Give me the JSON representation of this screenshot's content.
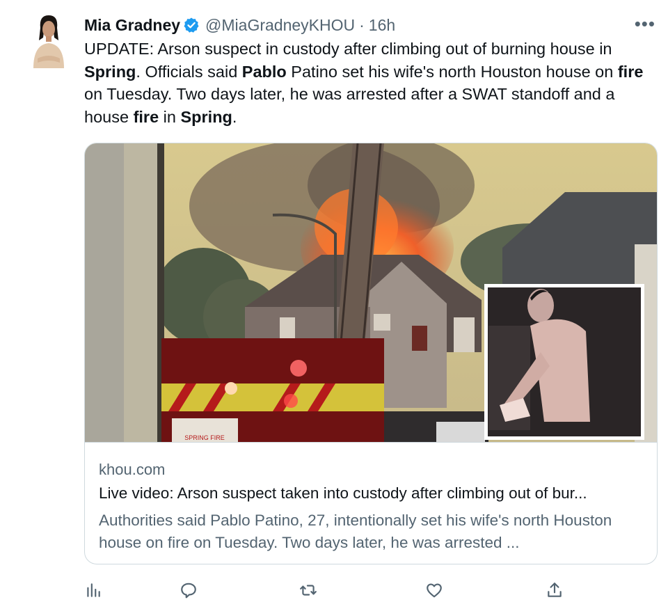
{
  "tweet": {
    "author_name": "Mia Gradney",
    "handle": "@MiaGradneyKHOU",
    "separator": "·",
    "time": "16h",
    "more_label": "•••",
    "text_segments": [
      {
        "t": "UPDATE:  Arson suspect in custody after climbing out of burning house in ",
        "b": false
      },
      {
        "t": "Spring",
        "b": true
      },
      {
        "t": ".  Officials said ",
        "b": false
      },
      {
        "t": "Pablo",
        "b": true
      },
      {
        "t": " Patino set his wife's north Houston house on ",
        "b": false
      },
      {
        "t": "fire",
        "b": true
      },
      {
        "t": " on Tuesday. Two days later, he was arrested after a SWAT standoff and a house ",
        "b": false
      },
      {
        "t": "fire",
        "b": true
      },
      {
        "t": " in ",
        "b": false
      },
      {
        "t": "Spring",
        "b": true
      },
      {
        "t": ".",
        "b": false
      }
    ]
  },
  "card": {
    "domain": "khou.com",
    "title": "Live video: Arson suspect taken into custody after climbing out of bur...",
    "description": "Authorities said Pablo Patino, 27, intentionally set his wife's north Houston house on fire on Tuesday. Two days later, he was arrested ...",
    "image_sign_text": "SPRING FIRE"
  },
  "actions": [
    {
      "name": "analytics-icon"
    },
    {
      "name": "reply-icon"
    },
    {
      "name": "retweet-icon"
    },
    {
      "name": "like-icon"
    },
    {
      "name": "share-icon"
    }
  ],
  "colors": {
    "text": "#0f1419",
    "secondary": "#536471",
    "verified": "#1d9bf0",
    "border": "#cfd9de"
  }
}
